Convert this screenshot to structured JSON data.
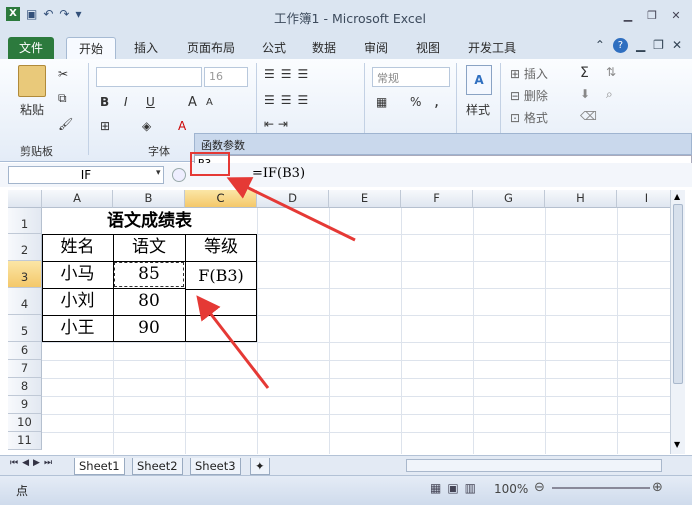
{
  "window": {
    "title": "工作簿1 - Microsoft Excel"
  },
  "tabs": [
    "文件",
    "开始",
    "插入",
    "页面布局",
    "公式",
    "数据",
    "审阅",
    "视图",
    "开发工具"
  ],
  "ribbon": {
    "paste_label": "粘贴",
    "clipboard_label": "剪贴板",
    "font_label": "字体",
    "font_size": "16",
    "number_format": "常规",
    "styles_label": "样式",
    "insert_label": "插入",
    "delete_label": "删除",
    "format_label": "格式",
    "underline": "U",
    "bold": "B",
    "italic": "I",
    "grow_font": "A",
    "shrink_font": "A",
    "percent": "%",
    "comma": ","
  },
  "dialog": {
    "title": "函数参数",
    "input_value": "B3"
  },
  "formula_bar": {
    "name_box": "IF",
    "formula": "=IF(B3)"
  },
  "columns": [
    "A",
    "B",
    "C",
    "D",
    "E",
    "F",
    "G",
    "H",
    "I"
  ],
  "rows": [
    "1",
    "2",
    "3",
    "4",
    "5",
    "6",
    "7",
    "8",
    "9",
    "10",
    "11"
  ],
  "cells": {
    "title": "语文成绩表",
    "h_name": "姓名",
    "h_chinese": "语文",
    "h_grade": "等级",
    "r3_name": "小马",
    "r3_score": "85",
    "r3_grade": "F(B3)",
    "r4_name": "小刘",
    "r4_score": "80",
    "r5_name": "小王",
    "r5_score": "90"
  },
  "sheets": [
    "Sheet1",
    "Sheet2",
    "Sheet3"
  ],
  "status": {
    "mode": "点",
    "zoom": "100%"
  },
  "colors": {
    "file_tab": "#2c7a3d",
    "selected_header": "#f4c86a",
    "annotation": "#e53935"
  }
}
